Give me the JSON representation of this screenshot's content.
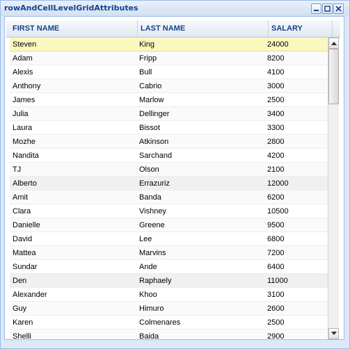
{
  "window": {
    "title": "rowAndCellLevelGridAttributes"
  },
  "grid": {
    "columns": [
      "FIRST NAME",
      "LAST NAME",
      "SALARY"
    ],
    "rows": [
      {
        "first": "Steven",
        "last": "King",
        "salary": "24000"
      },
      {
        "first": "Adam",
        "last": "Fripp",
        "salary": "8200"
      },
      {
        "first": "Alexis",
        "last": "Bull",
        "salary": "4100"
      },
      {
        "first": "Anthony",
        "last": "Cabrio",
        "salary": "3000"
      },
      {
        "first": "James",
        "last": "Marlow",
        "salary": "2500"
      },
      {
        "first": "Julia",
        "last": "Dellinger",
        "salary": "3400"
      },
      {
        "first": "Laura",
        "last": "Bissot",
        "salary": "3300"
      },
      {
        "first": "Mozhe",
        "last": "Atkinson",
        "salary": "2800"
      },
      {
        "first": "Nandita",
        "last": "Sarchand",
        "salary": "4200"
      },
      {
        "first": "TJ",
        "last": "Olson",
        "salary": "2100"
      },
      {
        "first": "Alberto",
        "last": "Errazuriz",
        "salary": "12000"
      },
      {
        "first": "Amit",
        "last": "Banda",
        "salary": "6200"
      },
      {
        "first": "Clara",
        "last": "Vishney",
        "salary": "10500"
      },
      {
        "first": "Danielle",
        "last": "Greene",
        "salary": "9500"
      },
      {
        "first": "David",
        "last": "Lee",
        "salary": "6800"
      },
      {
        "first": "Mattea",
        "last": "Marvins",
        "salary": "7200"
      },
      {
        "first": "Sundar",
        "last": "Ande",
        "salary": "6400"
      },
      {
        "first": "Den",
        "last": "Raphaely",
        "salary": "11000"
      },
      {
        "first": "Alexander",
        "last": "Khoo",
        "salary": "3100"
      },
      {
        "first": "Guy",
        "last": "Himuro",
        "salary": "2600"
      },
      {
        "first": "Karen",
        "last": "Colmenares",
        "salary": "2500"
      },
      {
        "first": "Shelli",
        "last": "Baida",
        "salary": "2900"
      }
    ]
  },
  "icons": {
    "minimize": "minimize-icon",
    "maximize": "maximize-icon",
    "close": "close-icon"
  }
}
